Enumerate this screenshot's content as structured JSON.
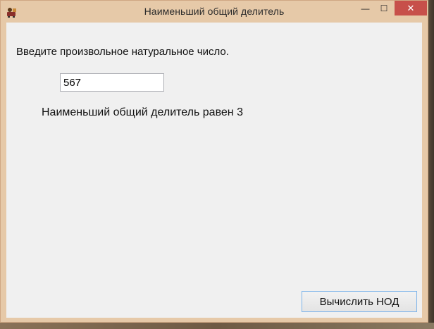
{
  "window": {
    "title": "Наименьший общий делитель",
    "icon": "app-icon",
    "controls": {
      "minimize_glyph": "—",
      "maximize_glyph": "☐",
      "close_glyph": "✕"
    }
  },
  "form": {
    "prompt_label": "Введите произвольное натуральное число.",
    "number_input": {
      "value": "567",
      "placeholder": ""
    },
    "result_text": "Наименьший общий делитель равен 3",
    "calculate_button_label": "Вычислить НОД"
  },
  "colors": {
    "title_bar": "#e6c9a8",
    "client_background": "#f0f0f0",
    "close_button": "#c7504a",
    "button_border": "#7eb4ea"
  }
}
